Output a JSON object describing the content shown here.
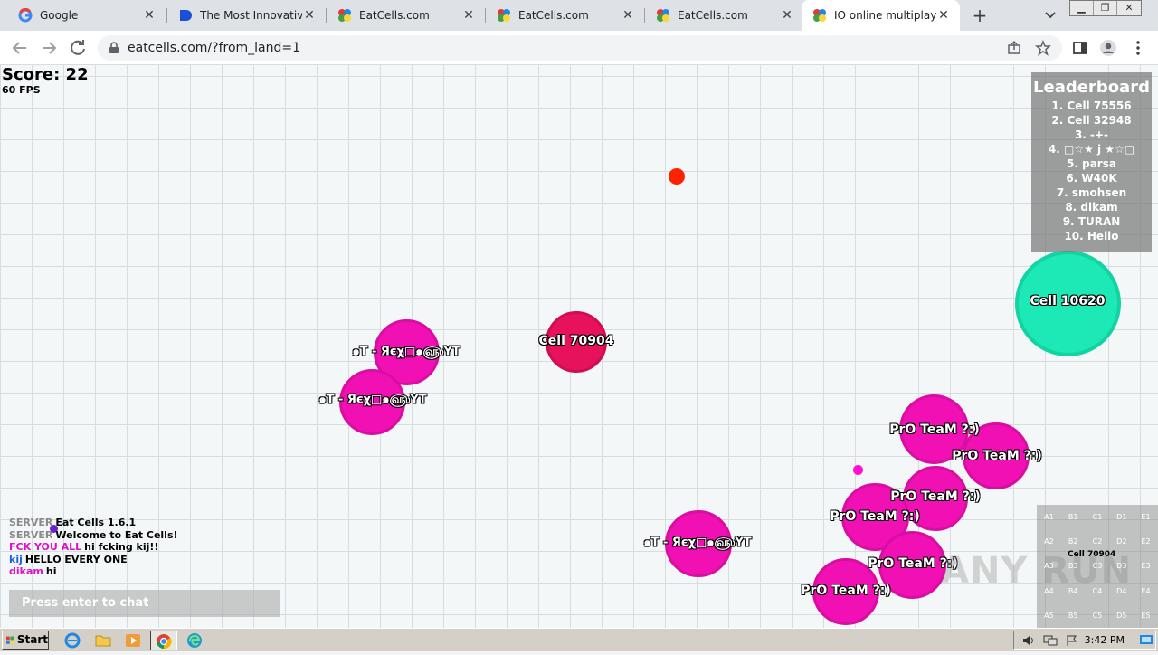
{
  "browser": {
    "tabs": [
      {
        "title": "Google",
        "icon": "google-icon"
      },
      {
        "title": "The Most Innovative Tr",
        "icon": "blue-logo-icon"
      },
      {
        "title": "EatCells.com",
        "icon": "eatcells-icon"
      },
      {
        "title": "EatCells.com",
        "icon": "eatcells-icon"
      },
      {
        "title": "EatCells.com",
        "icon": "eatcells-icon"
      },
      {
        "title": "IO online multiplayer ar",
        "icon": "eatcells-icon"
      }
    ],
    "active_tab": 5,
    "url": "eatcells.com/?from_land=1"
  },
  "game": {
    "score_label": "Score: 22",
    "fps_label": "60 FPS",
    "cells": [
      {
        "name": "Cell 70904",
        "color": "#e8115b"
      },
      {
        "name": "Cell 10620",
        "color": "#1de9b6"
      },
      {
        "name": "๑T - Яєχ□๑௵YT",
        "color": "#f010b4"
      },
      {
        "name": "๑T - Яєχ□๑௵YT",
        "color": "#f010b4"
      },
      {
        "name": "๑T - Яєχ□๑௵YT",
        "color": "#f010b4"
      },
      {
        "name": "PrO TeaM ?:)",
        "color": "#f010b4"
      },
      {
        "name": "PrO TeaM ?:)",
        "color": "#f010b4"
      },
      {
        "name": "PrO TeaM ?:)",
        "color": "#f010b4"
      },
      {
        "name": "PrO TeaM ?:)",
        "color": "#f010b4"
      },
      {
        "name": "PrO TeaM ?:)",
        "color": "#f010b4"
      },
      {
        "name": "PrO TeaM ?:)",
        "color": "#f010b4"
      }
    ],
    "leaderboard": {
      "title": "Leaderboard",
      "entries": [
        "1. Cell 75556",
        "2. Cell 32948",
        "3. -+-",
        "4. □☆★ j ★☆□",
        "5. parsa",
        "6. W40K",
        "7. smohsen",
        "8. dikam",
        "9. TURAN",
        "10. Hello"
      ]
    },
    "chat": [
      {
        "who": "SERVER",
        "who_color": "#8a8a8a",
        "msg": "Eat Cells 1.6.1"
      },
      {
        "who": "SERVER",
        "who_color": "#8a8a8a",
        "msg": "Welcome to Eat Cells!"
      },
      {
        "who": "FCK YOU ALL",
        "who_color": "#e010c8",
        "msg": "hi fcking kij!!"
      },
      {
        "who": "kij",
        "who_color": "#2060e0",
        "msg": "HELLO EVERY ONE"
      },
      {
        "who": "dikam",
        "who_color": "#e010c8",
        "msg": "hi"
      }
    ],
    "chat_placeholder": "Press enter to chat",
    "minimap": {
      "grid": [
        [
          "A1",
          "B1",
          "C1",
          "D1",
          "E1"
        ],
        [
          "A2",
          "B2",
          "C2",
          "D2",
          "E2"
        ],
        [
          "A3",
          "B3",
          "C3",
          "D3",
          "E3"
        ],
        [
          "A4",
          "B4",
          "C4",
          "D4",
          "E4"
        ],
        [
          "A5",
          "B5",
          "C5",
          "D5",
          "E5"
        ]
      ],
      "player_label": "Cell 70904"
    },
    "watermark": "ANY RUN"
  },
  "taskbar": {
    "start_label": "Start",
    "clock": "3:42 PM"
  }
}
